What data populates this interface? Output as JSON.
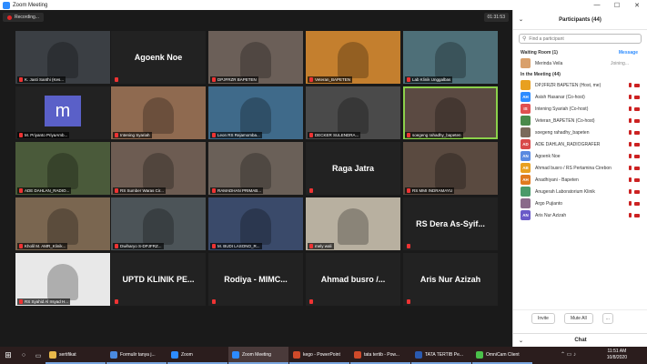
{
  "window": {
    "title": "Zoom Meeting",
    "minimize": "—",
    "maximize": "☐",
    "close": "✕"
  },
  "gallery": {
    "recording": "Recording...",
    "timer": "01:31:53",
    "tiles": [
      {
        "name": "K. Jasti Santhi (Kes...",
        "big": "",
        "avatar": "",
        "bg": "#3b3f44",
        "video": true
      },
      {
        "name": "",
        "big": "Agoenk Noe",
        "avatar": "",
        "bg": "#222"
      },
      {
        "name": "DPJFRZR BAPETEN",
        "big": "",
        "avatar": "",
        "bg": "#6b5f58",
        "video": true
      },
      {
        "name": "Veteran_BAPETEN",
        "big": "",
        "avatar": "",
        "bg": "#c47f2e",
        "video": true
      },
      {
        "name": "Lab Klinik Unggalbas",
        "big": "",
        "avatar": "",
        "bg": "#4e6f78",
        "video": true
      },
      {
        "name": "M. Priyanto PriyaAmb...",
        "big": "",
        "avatar": "m",
        "bg": "#222"
      },
      {
        "name": "Intening Syariah",
        "big": "",
        "avatar": "",
        "bg": "#8f6a50",
        "video": true
      },
      {
        "name": "Leon RS Rejamomba...",
        "big": "",
        "avatar": "",
        "bg": "#3f6a8a",
        "video": true
      },
      {
        "name": "DECKER SULENDRA...",
        "big": "",
        "avatar": "",
        "bg": "#4a4a4a",
        "video": true
      },
      {
        "name": "soegeng rahadhy_bapeten",
        "big": "",
        "avatar": "",
        "bg": "#5b4a42",
        "video": true,
        "highlight": true
      },
      {
        "name": "ADE DAHLAN_RADIO...",
        "big": "",
        "avatar": "",
        "bg": "#4a5a3a",
        "video": true
      },
      {
        "name": "RS Sumber Waras Cir...",
        "big": "",
        "avatar": "",
        "bg": "#6d5c52",
        "video": true
      },
      {
        "name": "RAMADHAN PRIMAB...",
        "big": "",
        "avatar": "",
        "bg": "#6a6058",
        "video": true
      },
      {
        "name": "",
        "big": "Raga Jatra",
        "avatar": "",
        "bg": "#222"
      },
      {
        "name": "RS MMI INDRAMAYU",
        "big": "",
        "avatar": "",
        "bg": "#5a4a40",
        "video": true
      },
      {
        "name": "Kholil M. AMR_Klinik...",
        "big": "",
        "avatar": "",
        "bg": "#7a6650",
        "video": true
      },
      {
        "name": "Dwiharyo S-DPJFRZ...",
        "big": "",
        "avatar": "",
        "bg": "#4c5458",
        "video": true
      },
      {
        "name": "M. BUDI LASONO_R...",
        "big": "",
        "avatar": "",
        "bg": "#3a4a6a",
        "video": true
      },
      {
        "name": "mely wali",
        "big": "",
        "avatar": "",
        "bg": "#b8b0a0",
        "video": true
      },
      {
        "name": "",
        "big": "RS Dera As-Syif...",
        "avatar": "",
        "bg": "#222"
      },
      {
        "name": "RS Syahid Al Irsyad H...",
        "big": "",
        "avatar": "",
        "bg": "#e8e8e8",
        "video": true
      },
      {
        "name": "",
        "big": "UPTD KLINIK PE...",
        "avatar": "",
        "bg": "#222"
      },
      {
        "name": "",
        "big": "Rodiya - MIMC...",
        "avatar": "",
        "bg": "#222"
      },
      {
        "name": "",
        "big": "Ahmad busro /...",
        "avatar": "",
        "bg": "#222"
      },
      {
        "name": "",
        "big": "Aris Nur Azizah",
        "avatar": "",
        "bg": "#222"
      }
    ]
  },
  "panel": {
    "title": "Participants (44)",
    "search_placeholder": "Find a participant",
    "waiting_label": "Waiting Room (1)",
    "message_label": "Message",
    "waiting": [
      {
        "initials": "",
        "name": "Merinda Veila",
        "status": "Joining...",
        "color": "#d9a06b"
      }
    ],
    "inmeeting_label": "In the Meeting (44)",
    "participants": [
      {
        "initials": "",
        "name": "DPJFRZR BAPETEN (Host, me)",
        "color": "#e8a020"
      },
      {
        "initials": "AH",
        "name": "Asish Hasanar (Co-host)",
        "color": "#2d8cff"
      },
      {
        "initials": "IS",
        "name": "Intening Syariah (Co-host)",
        "color": "#e05050"
      },
      {
        "initials": "",
        "name": "Veteran_BAPETEN (Co-host)",
        "color": "#4a8a4a"
      },
      {
        "initials": "",
        "name": "soegeng rahadhy_bapeten",
        "color": "#7a6a5a"
      },
      {
        "initials": "AD",
        "name": "ADE DAHLAN_RADIOGRAFER",
        "color": "#d84a4a"
      },
      {
        "initials": "AN",
        "name": "Agoenk Noe",
        "color": "#5a8ae0"
      },
      {
        "initials": "AB",
        "name": "Ahmad busro / RS Pertamina Cirebon",
        "color": "#e8a020"
      },
      {
        "initials": "AH",
        "name": "Anadhiyani - Bapeten",
        "color": "#e07a20"
      },
      {
        "initials": "",
        "name": "Anugerah Laboratorium Klinik",
        "color": "#4a9a6a"
      },
      {
        "initials": "",
        "name": "Argo Pujianto",
        "color": "#8a6a8a"
      },
      {
        "initials": "AN",
        "name": "Aris Nur Azizah",
        "color": "#6a5ac8"
      }
    ],
    "invite_label": "Invite",
    "muteall_label": "Mute All",
    "more_label": "...",
    "chat_label": "Chat"
  },
  "taskbar": {
    "apps": [
      {
        "label": "sertifikat",
        "color": "#e8b84a"
      },
      {
        "label": "Formulir tanya j...",
        "color": "#4a8ae0"
      },
      {
        "label": "Zoom",
        "color": "#2d8cff"
      },
      {
        "label": "Zoom Meeting",
        "color": "#2d8cff",
        "active": true
      },
      {
        "label": "kego - PowerPoint",
        "color": "#d04a2a"
      },
      {
        "label": "tata tertib - Pow...",
        "color": "#d04a2a"
      },
      {
        "label": "TATA TERTIB Pe...",
        "color": "#2a5ab0"
      },
      {
        "label": "OmniCam Client",
        "color": "#4ac04a"
      }
    ],
    "time": "11:51 AM",
    "date": "10/8/2020"
  }
}
